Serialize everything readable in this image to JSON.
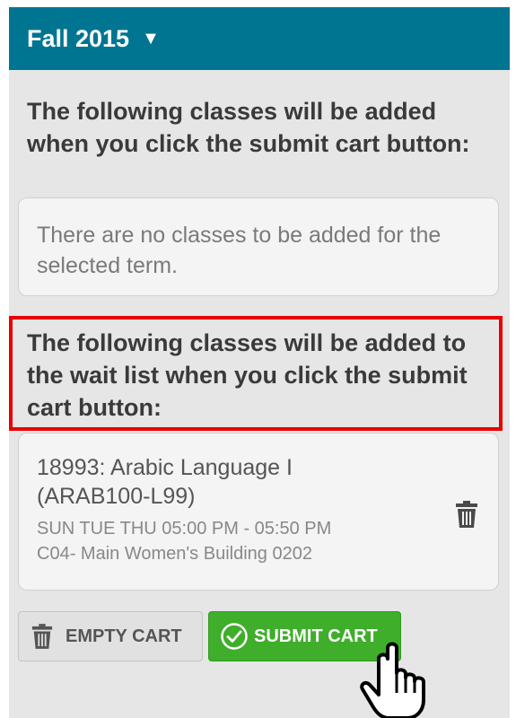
{
  "header": {
    "term": "Fall 2015",
    "caret": "▼"
  },
  "added_section": {
    "heading": "The following classes will be added when you click the submit cart button:",
    "empty_message": "There are no classes to be added for the selected term."
  },
  "waitlist_section": {
    "heading": "The following classes will be added to the wait list when you click the submit cart button:",
    "classes": [
      {
        "title_line1": "18993: Arabic Language I",
        "title_line2": "(ARAB100-L99)",
        "schedule": "SUN TUE THU 05:00 PM - 05:50 PM",
        "location": "C04- Main Women's Building 0202"
      }
    ]
  },
  "buttons": {
    "empty_cart": "EMPTY CART",
    "submit_cart": "SUBMIT CART"
  },
  "colors": {
    "header_bg": "#007591",
    "highlight_border": "#ea0000",
    "submit_green": "#3fae2b",
    "panel_bg": "#e6e6e6"
  },
  "icons": [
    "caret-down-icon",
    "trash-icon",
    "check-circle-icon",
    "pointer-hand-icon"
  ]
}
